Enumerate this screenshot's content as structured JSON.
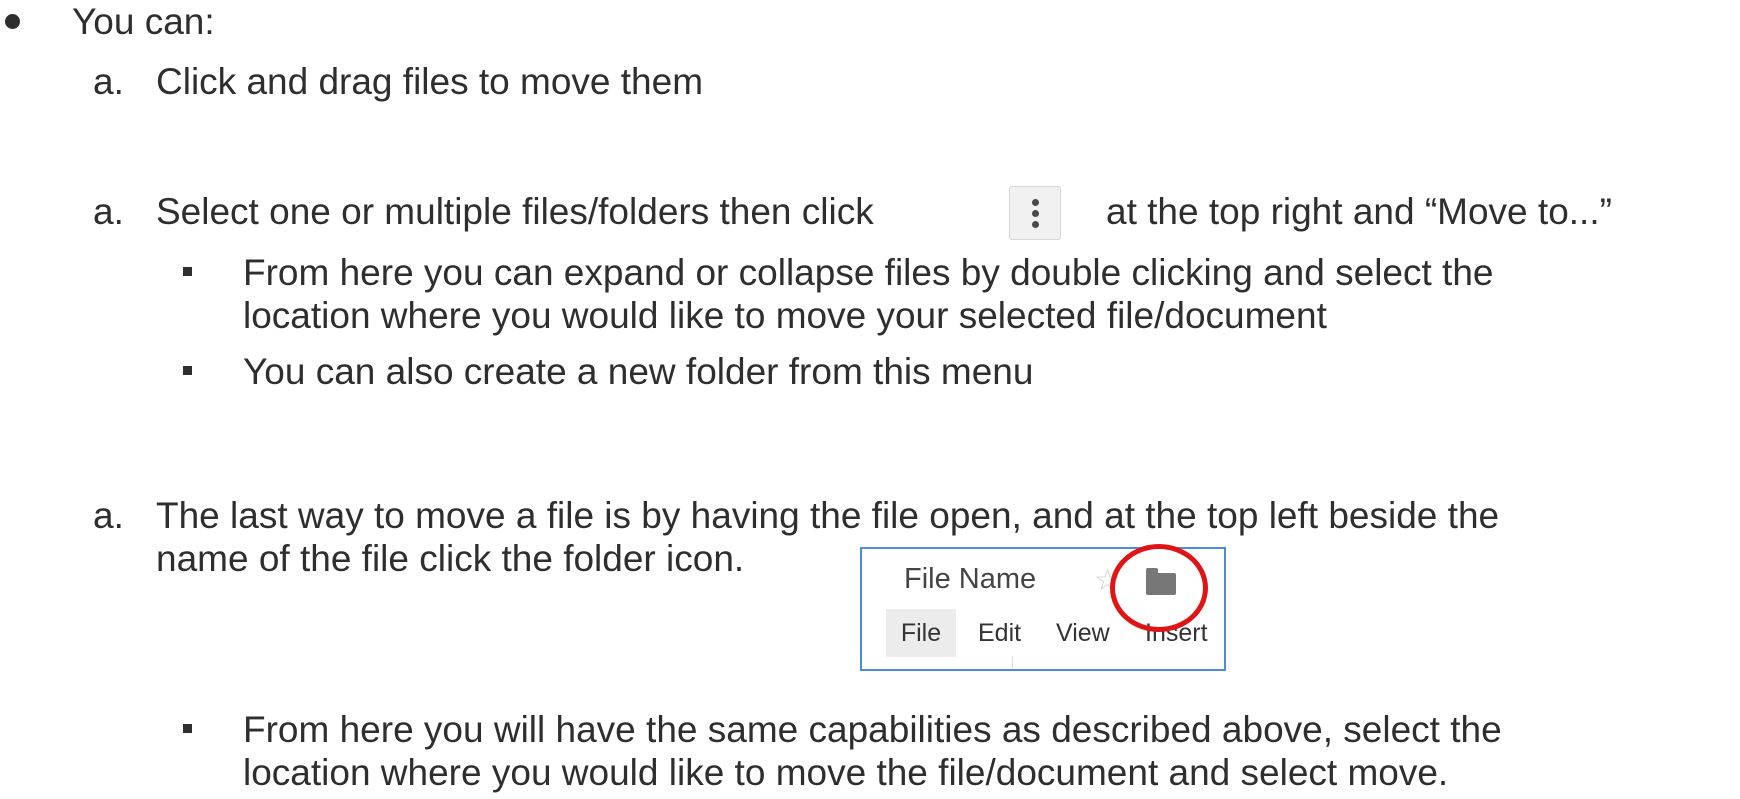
{
  "lines": {
    "intro": "You can:",
    "item1_marker": "a.",
    "item1": "Click and drag files to move them",
    "item2_marker": "a.",
    "item2_pre": "Select one or multiple files/folders then click",
    "item2_post": "at the top right and “Move to...”",
    "sub1_line1": "From here you can expand or collapse files by double clicking and select the",
    "sub1_line2": "location where you would like to move your selected file/document",
    "sub2": "You can also create a new folder from this menu",
    "item3_marker": "a.",
    "item3_line1": "The last way to move a file is by having the file open, and at the top left beside the",
    "item3_line2": "name of the file click the folder icon.",
    "sub3_line1": "From here you will have the same capabilities as described above, select the",
    "sub3_line2": "location where you would like to move the file/document and select move."
  },
  "icons": {
    "kebab": "more-vert-icon",
    "star": "star-icon",
    "folder": "folder-icon"
  },
  "screenshot": {
    "file_name": "File Name",
    "star_glyph": "☆",
    "menu": [
      "File",
      "Edit",
      "View",
      "Insert"
    ]
  },
  "colors": {
    "text": "#2e2e2e",
    "highlight_circle": "#e01414",
    "screenshot_border": "#4e8cd8"
  }
}
